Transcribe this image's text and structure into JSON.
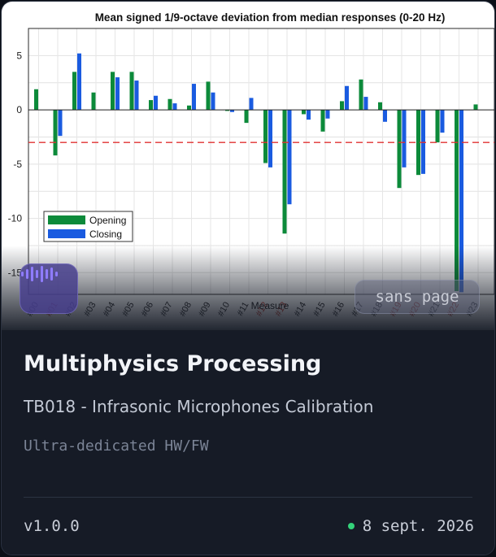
{
  "card": {
    "title": "Multiphysics Processing",
    "subtitle": "TB018 - Infrasonic Microphones Calibration",
    "description": "Ultra-dedicated HW/FW",
    "version": "v1.0.0",
    "date": "8 sept. 2026",
    "badge": "sans page",
    "icon": "audio-waveform-icon",
    "status_color": "#34d37a"
  },
  "chart_data": {
    "type": "bar",
    "title": "Mean signed 1/9-octave deviation from median responses (0-20 Hz)",
    "xlabel": "Measure",
    "ylabel": "",
    "ylim": [
      -17,
      7.5
    ],
    "yticks": [
      5,
      0,
      -5,
      -10,
      -15
    ],
    "grid": true,
    "legend_position": "left",
    "threshold": -3,
    "categories": [
      "#00",
      "#01",
      "#02",
      "#03",
      "#04",
      "#05",
      "#06",
      "#07",
      "#08",
      "#09",
      "#10",
      "#11",
      "#12",
      "#13",
      "#14",
      "#15",
      "#16",
      "#17",
      "#18",
      "#19",
      "#20",
      "#21",
      "#22",
      "#23"
    ],
    "highlighted_categories": [
      "#01",
      "#12",
      "#13",
      "#19",
      "#20",
      "#22"
    ],
    "series": [
      {
        "name": "Opening",
        "color": "#0c8a3a",
        "values": [
          1.9,
          -4.2,
          3.5,
          1.6,
          3.5,
          3.5,
          0.9,
          1.0,
          0.4,
          2.6,
          -0.1,
          -1.2,
          -4.9,
          -11.4,
          -0.4,
          -2.0,
          0.8,
          2.8,
          0.7,
          -7.2,
          -6.0,
          -3.0,
          -16.7,
          0.5
        ]
      },
      {
        "name": "Closing",
        "color": "#1a5be0",
        "values": [
          null,
          -2.4,
          5.2,
          null,
          3.0,
          2.7,
          1.3,
          0.6,
          2.4,
          1.6,
          -0.2,
          1.1,
          -5.3,
          -8.7,
          -0.9,
          -0.8,
          2.2,
          1.2,
          -1.1,
          -5.3,
          -5.9,
          -2.1,
          -16.8,
          null
        ]
      }
    ]
  }
}
